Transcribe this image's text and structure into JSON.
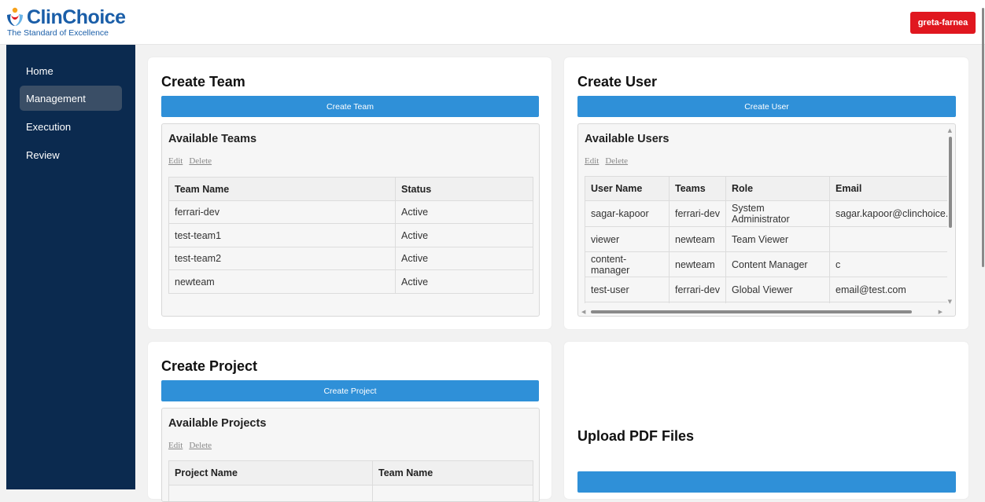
{
  "brand": {
    "name": "ClinChoice",
    "tagline": "The Standard of Excellence"
  },
  "user": {
    "name": "greta-farnea"
  },
  "colors": {
    "brand_blue": "#1a5ea8",
    "sidebar": "#0b2a4f",
    "accent_red": "#e0171f",
    "button_blue": "#2f90d8"
  },
  "nav": {
    "items": [
      {
        "label": "Home"
      },
      {
        "label": "Management",
        "active": true
      },
      {
        "label": "Execution"
      },
      {
        "label": "Review"
      }
    ]
  },
  "teams": {
    "title": "Create Team",
    "button": "Create Team",
    "panel_title": "Available Teams",
    "edit": "Edit",
    "delete": "Delete",
    "columns": [
      "Team Name",
      "Status"
    ],
    "rows": [
      [
        "ferrari-dev",
        "Active"
      ],
      [
        "test-team1",
        "Active"
      ],
      [
        "test-team2",
        "Active"
      ],
      [
        "newteam",
        "Active"
      ]
    ]
  },
  "users": {
    "title": "Create User",
    "button": "Create User",
    "panel_title": "Available Users",
    "edit": "Edit",
    "delete": "Delete",
    "columns": [
      "User Name",
      "Teams",
      "Role",
      "Email"
    ],
    "rows": [
      [
        "sagar-kapoor",
        "ferrari-dev",
        "System Administrator",
        "sagar.kapoor@clinchoice.cc"
      ],
      [
        "viewer",
        "newteam",
        "Team Viewer",
        ""
      ],
      [
        "content-manager",
        "newteam",
        "Content Manager",
        "c"
      ],
      [
        "test-user",
        "ferrari-dev",
        "Global Viewer",
        "email@test.com"
      ]
    ]
  },
  "projects": {
    "title": "Create Project",
    "button": "Create Project",
    "panel_title": "Available Projects",
    "edit": "Edit",
    "delete": "Delete",
    "columns": [
      "Project Name",
      "Team Name"
    ]
  },
  "upload": {
    "title": "Upload PDF Files"
  }
}
